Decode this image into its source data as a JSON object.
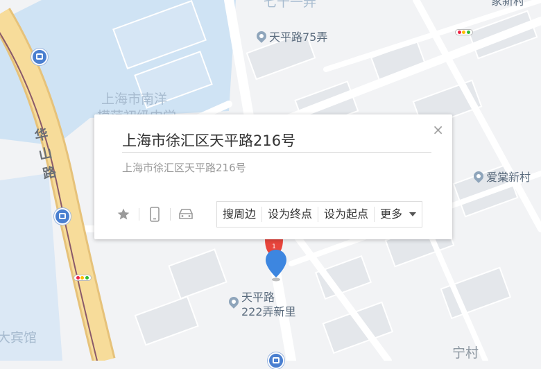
{
  "map": {
    "colors": {
      "background": "#f2f3f5",
      "building": "#e4e7eb",
      "water_block": "#cfe3f4",
      "main_road": "#f7dc9a",
      "main_road_edge": "#e6c27a",
      "rail": "#8a5a6a"
    },
    "labels": {
      "top_cut_a": "七十一弄",
      "top_cut_b": "家新村",
      "school_line1": "上海市南洋",
      "school_line2": "模范初级中学",
      "street_huashan": "华山路",
      "hotel": "大宾馆",
      "ningcun": "宁村"
    },
    "pois": [
      {
        "name": "天平路75弄",
        "icon": "poi-icon"
      },
      {
        "name": "爱棠新村",
        "icon": "poi-icon"
      },
      {
        "name": "天平路\n222弄新里",
        "icon": "poi-icon"
      }
    ]
  },
  "popup": {
    "title": "上海市徐汇区天平路216号",
    "address": "上海市徐汇区天平路216号",
    "close_glyph": "×",
    "icons": [
      "star-icon",
      "phone-icon",
      "car-icon"
    ],
    "actions": {
      "nearby": "搜周边",
      "set_end": "设为终点",
      "set_start": "设为起点",
      "more": "更多"
    }
  },
  "markers": {
    "selected_color": "#3d86e0",
    "result_color": "#e8453c",
    "result_badge": "1"
  }
}
